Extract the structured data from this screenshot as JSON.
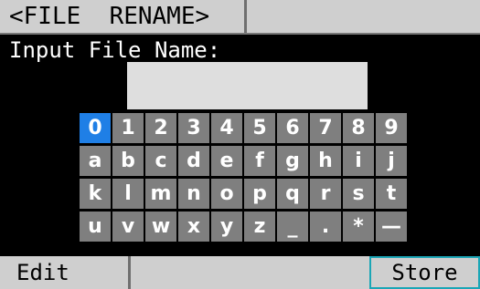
{
  "title_bar": {
    "title": "<FILE  RENAME>"
  },
  "prompt": {
    "label": "Input File Name:"
  },
  "filename": {
    "value": ""
  },
  "keyboard": {
    "selected_key": "0",
    "keys": [
      "0",
      "1",
      "2",
      "3",
      "4",
      "5",
      "6",
      "7",
      "8",
      "9",
      "a",
      "b",
      "c",
      "d",
      "e",
      "f",
      "g",
      "h",
      "i",
      "j",
      "k",
      "l",
      "m",
      "n",
      "o",
      "p",
      "q",
      "r",
      "s",
      "t",
      "u",
      "v",
      "w",
      "x",
      "y",
      "z",
      "_",
      ".",
      "*",
      "—"
    ]
  },
  "softkeys": {
    "left": "Edit",
    "right": "Store"
  },
  "colors": {
    "background": "#000000",
    "bar": "#cfcfcf",
    "key": "#7f7f7f",
    "selected_key": "#1f7fe6",
    "store_border": "#1aa6b6"
  }
}
